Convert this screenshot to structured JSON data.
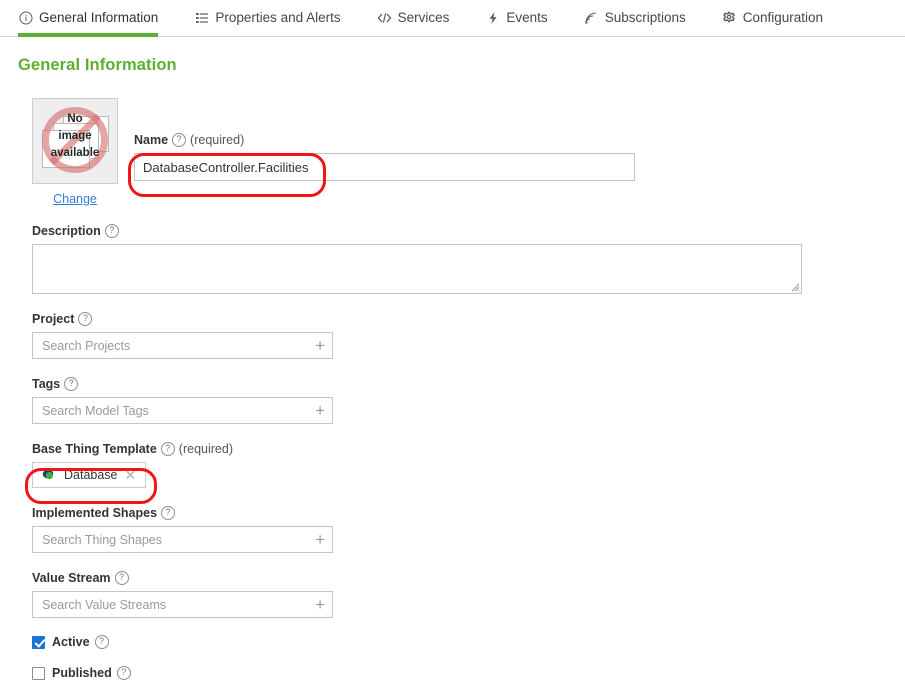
{
  "tabs": [
    {
      "label": "General Information",
      "icon": "info-circle-icon",
      "active": true
    },
    {
      "label": "Properties and Alerts",
      "icon": "list-icon",
      "active": false
    },
    {
      "label": "Services",
      "icon": "code-brackets-icon",
      "active": false
    },
    {
      "label": "Events",
      "icon": "lightning-bolt-icon",
      "active": false
    },
    {
      "label": "Subscriptions",
      "icon": "signal-waves-icon",
      "active": false
    },
    {
      "label": "Configuration",
      "icon": "gear-icon",
      "active": false
    }
  ],
  "page": {
    "title": "General Information"
  },
  "thumbnail": {
    "placeholder_line1": "No",
    "placeholder_line2": "image",
    "placeholder_line3": "available",
    "change_label": "Change"
  },
  "fields": {
    "name": {
      "label": "Name",
      "required_text": "(required)",
      "value": "DatabaseController.Facilities",
      "placeholder": ""
    },
    "description": {
      "label": "Description",
      "value": "",
      "placeholder": ""
    },
    "project": {
      "label": "Project",
      "placeholder": "Search Projects",
      "add_icon": "plus-icon"
    },
    "tags": {
      "label": "Tags",
      "placeholder": "Search Model Tags",
      "add_icon": "plus-icon"
    },
    "base_thing_template": {
      "label": "Base Thing Template",
      "required_text": "(required)",
      "chip_label": "Database",
      "chip_icon": "database-entity-icon",
      "remove_icon": "close-icon"
    },
    "implemented_shapes": {
      "label": "Implemented Shapes",
      "placeholder": "Search Thing Shapes",
      "add_icon": "plus-icon"
    },
    "value_stream": {
      "label": "Value Stream",
      "placeholder": "Search Value Streams",
      "add_icon": "plus-icon"
    },
    "active": {
      "label": "Active",
      "checked": true
    },
    "published": {
      "label": "Published",
      "checked": false
    }
  },
  "help_icon": "question-mark-icon",
  "colors": {
    "accent_green": "#5cb031",
    "link_blue": "#2f7ed8",
    "checkbox_blue": "#1b72d4",
    "annotation_red": "#f01616",
    "border_gray": "#c4c4c4"
  }
}
